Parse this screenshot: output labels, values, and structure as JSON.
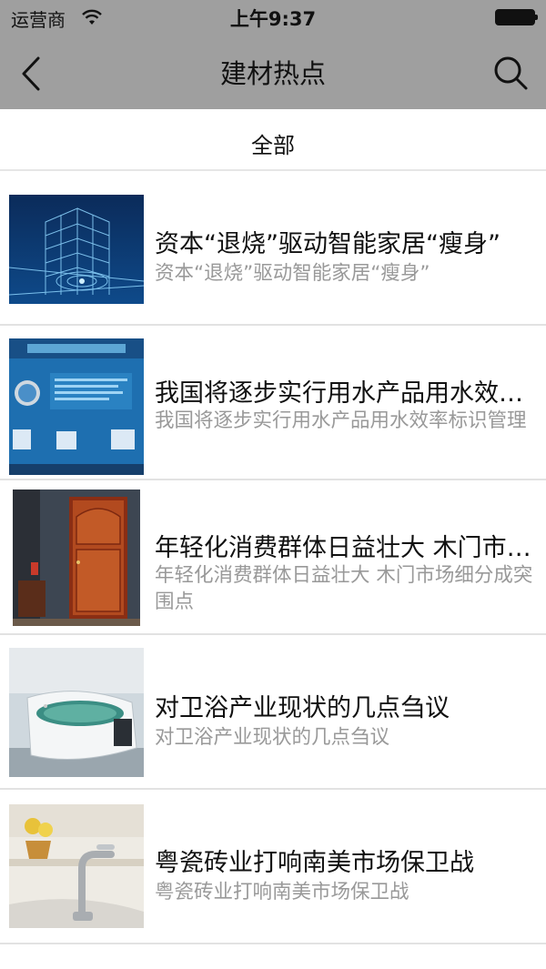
{
  "status_bar": {
    "carrier": "运营商",
    "time": "上午9:37"
  },
  "nav": {
    "title": "建材热点",
    "back_icon": "chevron-left-icon",
    "search_icon": "search-icon"
  },
  "category": {
    "active_tab": "全部"
  },
  "articles": [
    {
      "title": "资本“退烧”驱动智能家居“瘦身”",
      "summary": "资本“退烧”驱动智能家居“瘦身”",
      "image": "smart-building-thumbnail"
    },
    {
      "title": "我国将逐步实行用水产品用水效率标识管理",
      "summary": "我国将逐步实行用水产品用水效率标识管理",
      "image": "water-system-thumbnail"
    },
    {
      "title": "年轻化消费群体日益壮大 木门市场细分成突围点",
      "summary": "年轻化消费群体日益壮大 木门市场细分成突围点",
      "image": "wooden-door-thumbnail"
    },
    {
      "title": "对卫浴产业现状的几点刍议",
      "summary": "对卫浴产业现状的几点刍议",
      "image": "bathtub-thumbnail"
    },
    {
      "title": "粤瓷砖业打响南美市场保卫战",
      "summary": "粤瓷砖业打响南美市场保卫战",
      "image": "faucet-thumbnail"
    }
  ],
  "colors": {
    "header_bg": "#9f9f9f",
    "title_text": "#111111",
    "summary_text": "#999999",
    "divider": "#e2e2e2"
  }
}
